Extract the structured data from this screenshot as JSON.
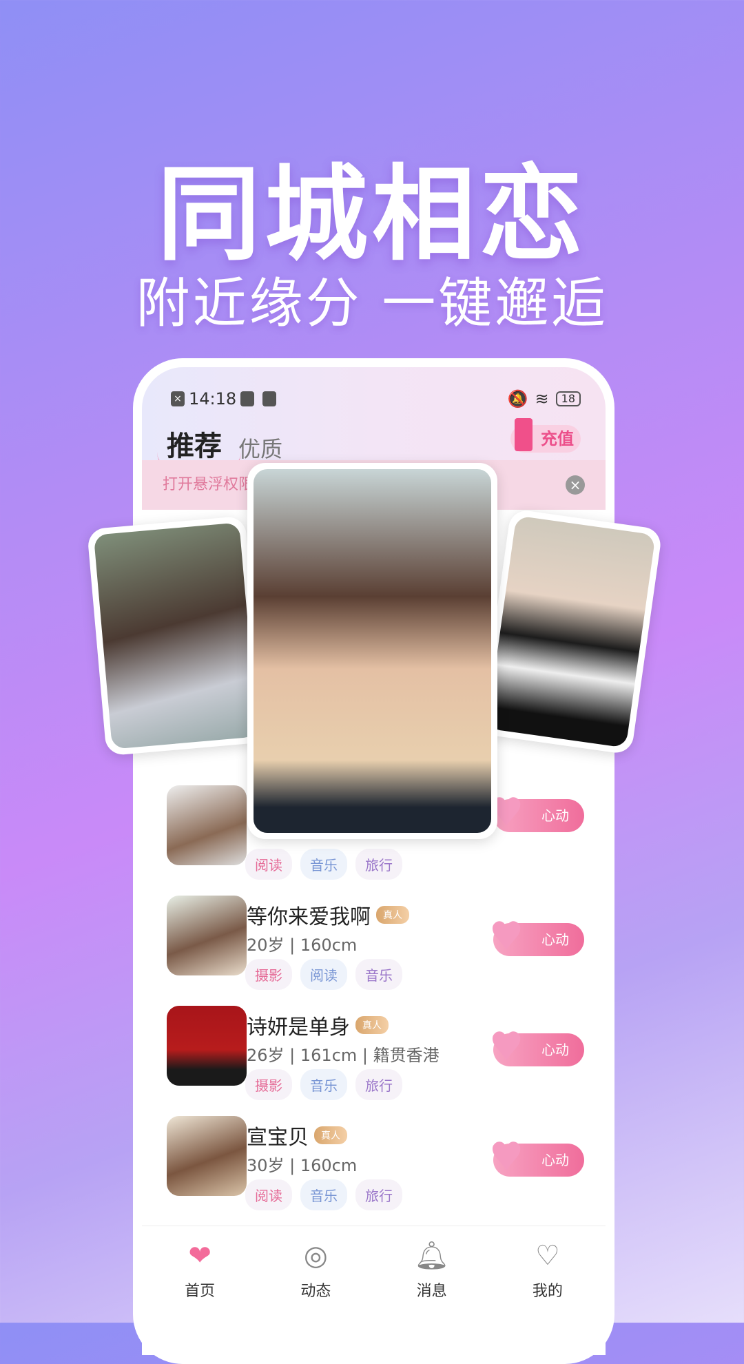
{
  "hero": {
    "title": "同城相恋",
    "subtitle": "附近缘分 一键邂逅"
  },
  "status_bar": {
    "time": "14:18",
    "battery": "18"
  },
  "header": {
    "tabs": [
      {
        "label": "推荐",
        "active": true
      },
      {
        "label": "优质",
        "active": false
      }
    ],
    "recharge_label": "充值"
  },
  "banner": {
    "text": "打开悬浮权限",
    "close_icon": "close-icon"
  },
  "list": [
    {
      "name": "",
      "badge": "",
      "info": "",
      "tags": [
        "阅读",
        "音乐",
        "旅行"
      ],
      "button": "心动"
    },
    {
      "name": "等你来爱我啊",
      "badge": "真人",
      "info": "20岁 | 160cm",
      "tags": [
        "摄影",
        "阅读",
        "音乐"
      ],
      "button": "心动"
    },
    {
      "name": "诗妍是单身",
      "badge": "真人",
      "info": "26岁 | 161cm |  籍贯香港",
      "tags": [
        "摄影",
        "音乐",
        "旅行"
      ],
      "button": "心动"
    },
    {
      "name": "宣宝贝",
      "badge": "真人",
      "info": "30岁 | 160cm",
      "tags": [
        "阅读",
        "音乐",
        "旅行"
      ],
      "button": "心动"
    }
  ],
  "nav": [
    {
      "label": "首页",
      "icon": "home-heart-icon",
      "active": true
    },
    {
      "label": "动态",
      "icon": "compass-icon"
    },
    {
      "label": "消息",
      "icon": "bell-icon"
    },
    {
      "label": "我的",
      "icon": "heart-smile-icon"
    }
  ],
  "colors": {
    "accent": "#f06d9b",
    "badge": "#d9a66d"
  }
}
